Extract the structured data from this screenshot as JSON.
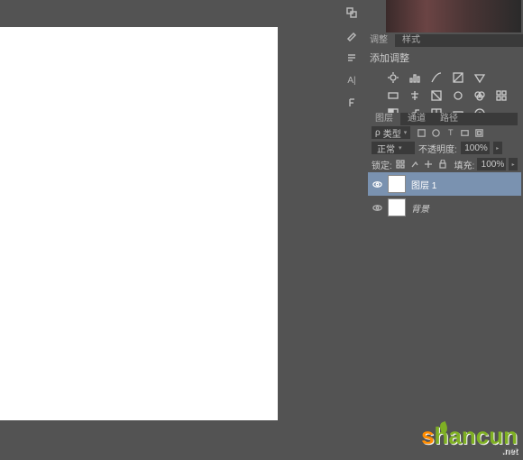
{
  "tabs": {
    "adjust": "调整",
    "style": "样式",
    "layers": "图层",
    "channels": "通道",
    "paths": "路径"
  },
  "adjust": {
    "add_label": "添加调整"
  },
  "layer_toolbar": {
    "type_label": "类型"
  },
  "layer_controls": {
    "blend_mode": "正常",
    "opacity_label": "不透明度:",
    "opacity_value": "100%",
    "fill_label": "填充:",
    "fill_value": "100%"
  },
  "lock": {
    "label": "锁定:"
  },
  "layers": [
    {
      "name": "图层 1",
      "selected": true
    },
    {
      "name": "背景",
      "selected": false
    }
  ],
  "watermark": {
    "brand": "shancun",
    "sub": ".net"
  }
}
